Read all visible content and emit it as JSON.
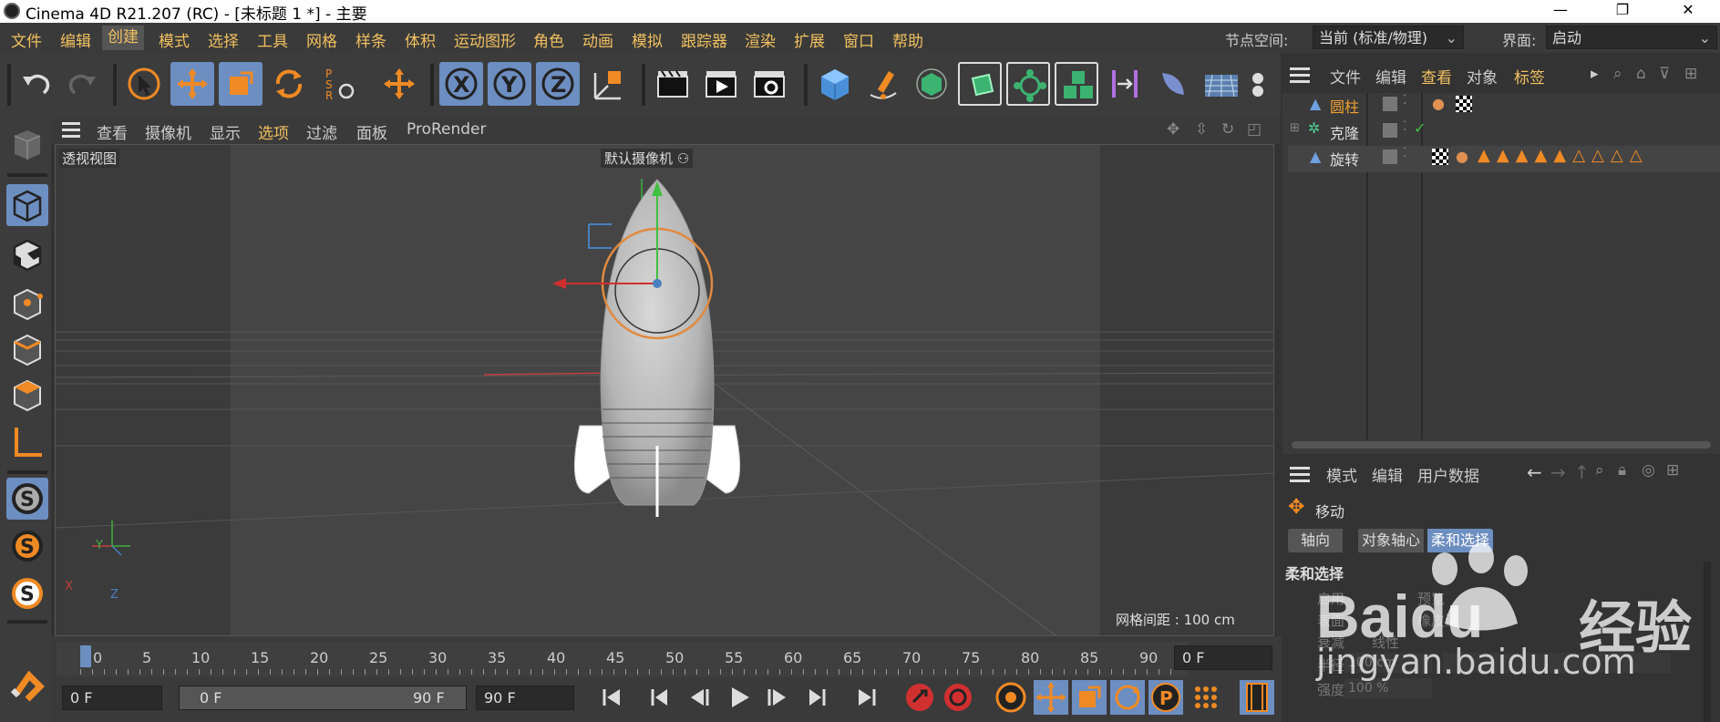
{
  "window": {
    "title": "Cinema 4D R21.207 (RC) - [未标题 1 *] - 主要",
    "minimize": "—",
    "maximize": "❐",
    "close": "✕"
  },
  "menubar": {
    "items": [
      "文件",
      "编辑",
      "创建",
      "模式",
      "选择",
      "工具",
      "网格",
      "样条",
      "体积",
      "运动图形",
      "角色",
      "动画",
      "模拟",
      "跟踪器",
      "渲染",
      "扩展",
      "窗口",
      "帮助"
    ],
    "active": "创建",
    "node_space_label": "节点空间:",
    "node_space_value": "当前 (标准/物理)",
    "layout_label": "界面:",
    "layout_value": "启动"
  },
  "viewport": {
    "menu": [
      "查看",
      "摄像机",
      "显示",
      "选项",
      "过滤",
      "面板",
      "ProRender"
    ],
    "highlight": "选项",
    "view_name": "透视视图",
    "camera_name": "默认摄像机",
    "grid_spacing": "网格间距 : 100 cm",
    "axis_labels": {
      "x": "X",
      "y": "Y",
      "z": "Z"
    }
  },
  "object_manager": {
    "menu": [
      "文件",
      "编辑",
      "查看",
      "对象",
      "标签"
    ],
    "highlight": "查看",
    "objects": [
      {
        "name": "圆柱",
        "selected": true
      },
      {
        "name": "克隆",
        "selected": false,
        "check": "✓"
      },
      {
        "name": "旋转",
        "selected": false
      }
    ]
  },
  "attribute_manager": {
    "menu": [
      "模式",
      "编辑",
      "用户数据"
    ],
    "tool_name": "移动",
    "tabs": [
      "轴向",
      "对象轴心",
      "柔和选择"
    ],
    "active_tab": "柔和选择",
    "section_title": "柔和选择",
    "faded_rows": [
      {
        "label": "启用",
        "extra": "预览"
      },
      {
        "label": "表面",
        "extra": "橡皮泥"
      },
      {
        "label": "衰减",
        "extra": "线性"
      },
      {
        "label": "半径",
        "value": "100 cm"
      },
      {
        "label": "强度",
        "value": "100 %"
      }
    ]
  },
  "timeline": {
    "ticks": [
      "0",
      "5",
      "10",
      "15",
      "20",
      "25",
      "30",
      "35",
      "40",
      "45",
      "50",
      "55",
      "60",
      "65",
      "70",
      "75",
      "80",
      "85",
      "90"
    ],
    "current_frame": "0 F",
    "start_field": "0 F",
    "range_start": "0 F",
    "range_end": "90 F",
    "end_field": "90 F"
  },
  "watermark": {
    "brand": "Baidu",
    "cn": "经验",
    "url": "jingyan.baidu.com"
  },
  "colors": {
    "accent": "#f0c060",
    "highlight_blue": "#6d8ec0",
    "orange": "#f08a24"
  }
}
